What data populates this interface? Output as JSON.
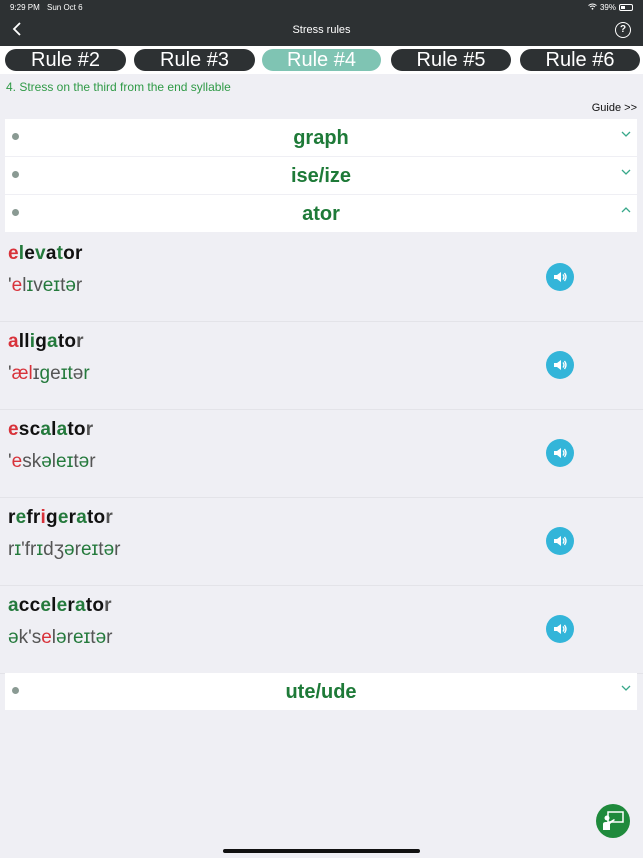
{
  "status": {
    "time": "9:29 PM",
    "date": "Sun Oct 6",
    "battery": "39%"
  },
  "nav": {
    "back_icon": "chevron-left-icon",
    "title": "Stress rules",
    "help_label": "?"
  },
  "tabs": [
    {
      "label": "Rule #2",
      "active": false
    },
    {
      "label": "Rule #3",
      "active": false
    },
    {
      "label": "Rule #4",
      "active": true
    },
    {
      "label": "Rule #5",
      "active": false
    },
    {
      "label": "Rule #6",
      "active": false
    }
  ],
  "rule": {
    "description": "4. Stress on the third from the end syllable",
    "guide_link": "Guide >>"
  },
  "sections": [
    {
      "title": "graph",
      "expanded": false
    },
    {
      "title": "ise/ize",
      "expanded": false
    },
    {
      "title": "ator",
      "expanded": true
    },
    {
      "title": "ute/ude",
      "expanded": false
    }
  ],
  "words": [
    {
      "word": "elevator",
      "ipa": "'elɪveɪtər"
    },
    {
      "word": "alligator",
      "ipa": "'ælɪgeɪtər"
    },
    {
      "word": "escalator",
      "ipa": "'eskəleɪtər"
    },
    {
      "word": "refrigerator",
      "ipa": "rɪ'frɪdʒəreɪtər"
    },
    {
      "word": "accelerator",
      "ipa": "ək'seləreɪtər"
    }
  ],
  "colors": {
    "stress": "#d8323a",
    "vowel": "#247a3c",
    "consonant": "#111111",
    "accent": "#33b5d9",
    "dark_bar": "#2d3133",
    "active_tab": "#7fc4b3"
  }
}
